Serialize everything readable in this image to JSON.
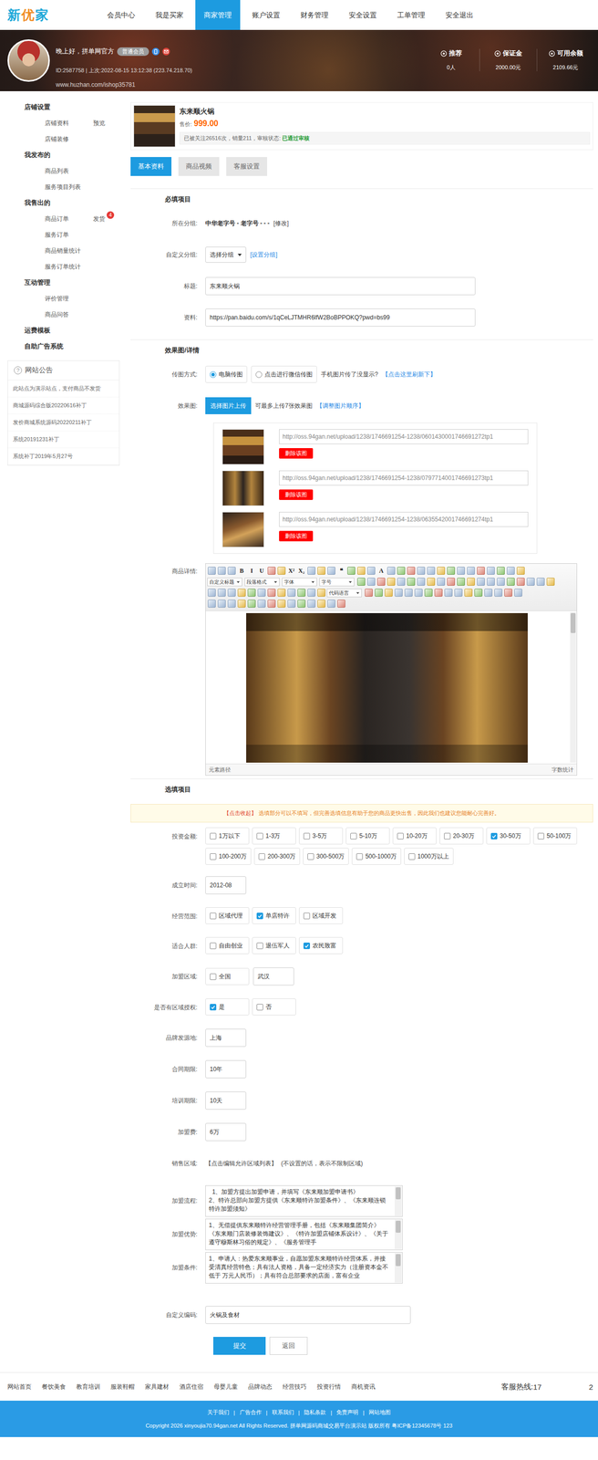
{
  "topnav": {
    "logo": [
      {
        "char": "新",
        "color": "#1aa7d8"
      },
      {
        "char": "优",
        "color": "#f08c1e"
      },
      {
        "char": "家",
        "color": "#1aa7d8"
      }
    ],
    "items": [
      {
        "label": "会员中心",
        "selected": false
      },
      {
        "label": "我是买家",
        "selected": false
      },
      {
        "label": "商家管理",
        "selected": true
      },
      {
        "label": "账户设置",
        "selected": false
      },
      {
        "label": "财务管理",
        "selected": false
      },
      {
        "label": "安全设置",
        "selected": false
      },
      {
        "label": "工单管理",
        "selected": false
      },
      {
        "label": "安全退出",
        "selected": false
      }
    ]
  },
  "banner": {
    "greeting": "晚上好，拼单网官方",
    "badge": "普通会员",
    "meta": "ID:2587758 | 上次:2022-08-15 13:12:38 (223.74.218.70)",
    "watermark": "www.huzhan.com/ishop35781",
    "stats": [
      {
        "label": "推荐",
        "value": "0人"
      },
      {
        "label": "保证金",
        "value": "2000.00元"
      },
      {
        "label": "可用余额",
        "value": "2109.66元"
      }
    ]
  },
  "sidebar": {
    "groups": [
      {
        "title": "店铺设置",
        "items": [
          {
            "label": "店铺资料",
            "extra": "预览"
          },
          {
            "label": "店铺装修"
          }
        ]
      },
      {
        "title": "我发布的",
        "items": [
          {
            "label": "商品列表"
          },
          {
            "label": "服务项目列表"
          }
        ]
      },
      {
        "title": "我售出的",
        "items": [
          {
            "label": "商品订单",
            "extra": "发货",
            "badge": "4"
          },
          {
            "label": "服务订单"
          },
          {
            "label": "商品销量统计"
          },
          {
            "label": "服务订单统计"
          }
        ]
      },
      {
        "title": "互动管理",
        "items": [
          {
            "label": "评价管理"
          },
          {
            "label": "商品问答"
          }
        ]
      },
      {
        "title": "运费模板",
        "items": []
      },
      {
        "title": "自助广告系统",
        "items": []
      }
    ],
    "notice": {
      "icon": "?",
      "title": "网站公告",
      "items": [
        "此站点为演示站点，支付商品不发货",
        "商城源码综合版20220616补丁",
        "发价商城系统源码20220211补丁",
        "系统20191231补丁",
        "系统补丁2019年5月27号"
      ]
    }
  },
  "product": {
    "name": "东来顺火锅",
    "price_label": "售价:",
    "price": "999.00",
    "stats": "已被关注26516次，销量211，审核状态: ",
    "status": "已通过审核"
  },
  "tabs": [
    {
      "label": "基本资料",
      "selected": true
    },
    {
      "label": "商品视频",
      "selected": false
    },
    {
      "label": "客服设置",
      "selected": false
    }
  ],
  "required": {
    "title": "必填项目",
    "group": {
      "label": "所在分组:",
      "value": "中华老字号 - 老字号 - - -",
      "link": "[修改]"
    },
    "custom_group": {
      "label": "自定义分组:",
      "select": "选择分组",
      "link": "[设置分组]"
    },
    "title_field": {
      "label": "标题:",
      "value": "东来顺火锅"
    },
    "resource": {
      "label": "资料:",
      "value": "https://pan.baidu.com/s/1qCeLJTMHR6lfW2BoBPPOKQ?pwd=bs99"
    }
  },
  "media": {
    "title": "效果图/详情",
    "upload_mode": {
      "label": "传图方式:",
      "options": [
        {
          "label": "电脑传图",
          "selected": true
        },
        {
          "label": "点击进行微信传图",
          "selected": false
        }
      ],
      "hint": "手机图片传了没显示?",
      "refresh": "【点击这里刷新下】"
    },
    "images": {
      "label": "效果图:",
      "button": "选择图片上传",
      "hint": "可最多上传7张效果图",
      "order": "【调整图片顺序】",
      "items": [
        {
          "url": "http://oss.94gan.net/upload/1238/1746691254-1238/0601430001746691272tp1",
          "delete": "删除该图"
        },
        {
          "url": "http://oss.94gan.net/upload/1238/1746691254-1238/0797714001746691273tp1",
          "delete": "删除该图"
        },
        {
          "url": "http://oss.94gan.net/upload/1238/1746691254-1238/0635542001746691274tp1",
          "delete": "删除该图"
        }
      ]
    },
    "detail": {
      "label": "商品详情:",
      "toolbar": [
        [
          {
            "kind": "icon"
          },
          {
            "kind": "icon"
          },
          {
            "kind": "icon"
          },
          {
            "kind": "text",
            "label": "B"
          },
          {
            "kind": "text",
            "label": "I"
          },
          {
            "kind": "text",
            "label": "U"
          },
          {
            "kind": "icon"
          },
          {
            "kind": "icon"
          },
          {
            "kind": "text",
            "label": "X²"
          },
          {
            "kind": "text",
            "label": "X₂"
          },
          {
            "kind": "icon"
          },
          {
            "kind": "icon"
          },
          {
            "kind": "icon"
          },
          {
            "kind": "text",
            "label": "❝"
          },
          {
            "kind": "icon"
          },
          {
            "kind": "icon"
          },
          {
            "kind": "icon"
          },
          {
            "kind": "text",
            "label": "A"
          },
          {
            "kind": "icon"
          },
          {
            "kind": "icon"
          },
          {
            "kind": "icon"
          },
          {
            "kind": "icon"
          },
          {
            "kind": "icon"
          },
          {
            "kind": "icon"
          },
          {
            "kind": "icon"
          },
          {
            "kind": "icon"
          },
          {
            "kind": "icon"
          },
          {
            "kind": "icon"
          },
          {
            "kind": "icon"
          },
          {
            "kind": "icon"
          },
          {
            "kind": "icon"
          },
          {
            "kind": "icon"
          }
        ],
        [
          {
            "kind": "select",
            "label": "自定义标题"
          },
          {
            "kind": "select",
            "label": "段落格式"
          },
          {
            "kind": "select",
            "label": "字体"
          },
          {
            "kind": "select",
            "label": "字号"
          },
          {
            "kind": "icon"
          },
          {
            "kind": "icon"
          },
          {
            "kind": "icon"
          },
          {
            "kind": "icon"
          },
          {
            "kind": "icon"
          },
          {
            "kind": "icon"
          },
          {
            "kind": "icon"
          },
          {
            "kind": "icon"
          },
          {
            "kind": "icon"
          },
          {
            "kind": "icon"
          },
          {
            "kind": "icon"
          },
          {
            "kind": "icon"
          },
          {
            "kind": "icon"
          },
          {
            "kind": "icon"
          },
          {
            "kind": "icon"
          },
          {
            "kind": "icon"
          },
          {
            "kind": "icon"
          },
          {
            "kind": "icon"
          },
          {
            "kind": "icon"
          },
          {
            "kind": "icon"
          }
        ],
        [
          {
            "kind": "icon"
          },
          {
            "kind": "icon"
          },
          {
            "kind": "icon"
          },
          {
            "kind": "icon"
          },
          {
            "kind": "icon"
          },
          {
            "kind": "icon"
          },
          {
            "kind": "icon"
          },
          {
            "kind": "icon"
          },
          {
            "kind": "icon"
          },
          {
            "kind": "icon"
          },
          {
            "kind": "icon"
          },
          {
            "kind": "icon"
          },
          {
            "kind": "select",
            "label": "代码语言"
          },
          {
            "kind": "icon"
          },
          {
            "kind": "icon"
          },
          {
            "kind": "icon"
          },
          {
            "kind": "icon"
          },
          {
            "kind": "icon"
          },
          {
            "kind": "icon"
          },
          {
            "kind": "icon"
          },
          {
            "kind": "icon"
          },
          {
            "kind": "icon"
          },
          {
            "kind": "icon"
          },
          {
            "kind": "icon"
          },
          {
            "kind": "icon"
          },
          {
            "kind": "icon"
          },
          {
            "kind": "icon"
          },
          {
            "kind": "icon"
          },
          {
            "kind": "icon"
          }
        ],
        [
          {
            "kind": "icon"
          },
          {
            "kind": "icon"
          },
          {
            "kind": "icon"
          },
          {
            "kind": "icon"
          },
          {
            "kind": "icon"
          },
          {
            "kind": "icon"
          },
          {
            "kind": "icon"
          },
          {
            "kind": "icon"
          },
          {
            "kind": "icon"
          },
          {
            "kind": "icon"
          },
          {
            "kind": "icon"
          },
          {
            "kind": "icon"
          },
          {
            "kind": "icon"
          },
          {
            "kind": "icon"
          }
        ]
      ],
      "path": "元素路径",
      "count": "字数统计"
    }
  },
  "optional": {
    "title": "选填项目",
    "notice": {
      "link": "【点击收起】",
      "text": "选填部分可以不填写，但完善选填信息有助于您的商品更快出售，因此我们也建议您能耐心完善好。"
    },
    "fields": [
      {
        "kind": "checks",
        "label": "投资金额:",
        "options": [
          {
            "label": "1万以下",
            "checked": false
          },
          {
            "label": "1-3万",
            "checked": false
          },
          {
            "label": "3-5万",
            "checked": false
          },
          {
            "label": "5-10万",
            "checked": false
          },
          {
            "label": "10-20万",
            "checked": false
          },
          {
            "label": "20-30万",
            "checked": false
          },
          {
            "label": "30-50万",
            "checked": true
          },
          {
            "label": "50-100万",
            "checked": false
          },
          {
            "label": "100-200万",
            "checked": false
          },
          {
            "label": "200-300万",
            "checked": false
          },
          {
            "label": "300-500万",
            "checked": false
          },
          {
            "label": "500-1000万",
            "checked": false
          },
          {
            "label": "1000万以上",
            "checked": false
          }
        ]
      },
      {
        "kind": "input",
        "label": "成立时间:",
        "value": "2012-08"
      },
      {
        "kind": "checks",
        "label": "经营范围:",
        "options": [
          {
            "label": "区域代理",
            "checked": false
          },
          {
            "label": "单店特许",
            "checked": true
          },
          {
            "label": "区域开发",
            "checked": false
          }
        ]
      },
      {
        "kind": "checks",
        "label": "适合人群:",
        "options": [
          {
            "label": "自由创业",
            "checked": false
          },
          {
            "label": "退伍军人",
            "checked": false
          },
          {
            "label": "农民致富",
            "checked": true
          }
        ]
      },
      {
        "kind": "checks_input",
        "label": "加盟区域:",
        "options": [
          {
            "label": "全国",
            "checked": false
          }
        ],
        "value": "武汉"
      },
      {
        "kind": "checks",
        "label": "是否有区域授权:",
        "options": [
          {
            "label": "是",
            "checked": true
          },
          {
            "label": "否",
            "checked": false
          }
        ]
      },
      {
        "kind": "input",
        "label": "品牌发源地:",
        "value": "上海"
      },
      {
        "kind": "input",
        "label": "合同期限:",
        "value": "10年"
      },
      {
        "kind": "input",
        "label": "培训期限:",
        "value": "10天"
      },
      {
        "kind": "input",
        "label": "加盟费:",
        "value": "6万"
      },
      {
        "kind": "link",
        "label": "销售区域:",
        "link": "【点击编辑允许区域列表】",
        "hint": "(不设置的话，表示不限制区域)"
      },
      {
        "kind": "textarea",
        "label": "加盟流程:",
        "value": "  1、加盟方提出加盟申请，并填写《东来顺加盟申请书》\n2、特许总部向加盟方提供《东来顺特许加盟条件》、《东来顺连锁特许加盟须知》"
      },
      {
        "kind": "textarea",
        "label": "加盟优势:",
        "value": "1、无偿提供东来顺特许经营管理手册，包括《东来顺集团简介》《东来顺门店装修装饰建议》、《特许加盟店铺体系设计》、《关于遵守穆斯林习俗的规定》、《服务管理手"
      },
      {
        "kind": "textarea",
        "label": "加盟条件:",
        "value": "1、申请人：热爱东来顺事业，自愿加盟东来顺特许经营体系，并接受清真经营特色；具有法人资格，具备一定经济实力（注册资本金不低于 万元人民币）；具有符合总部要求的店面，富有企业"
      },
      {
        "kind": "input_wide",
        "label": "自定义编码:",
        "value": "火锅及食材"
      }
    ]
  },
  "actions": {
    "submit": "提交",
    "back": "返回"
  },
  "footer": {
    "links": [
      "网站首页",
      "餐饮美食",
      "教育培训",
      "服装鞋帽",
      "家具建材",
      "酒店住宿",
      "母婴儿童",
      "品牌动态",
      "经营技巧",
      "投资行情",
      "商机资讯"
    ],
    "hotline": {
      "label": "客服热线:",
      "value": "17",
      "tail": "2"
    },
    "bottom_links": [
      "关于我们",
      "广告合作",
      "联系我们",
      "隐私条款",
      "免责声明",
      "网站地图"
    ],
    "separator": "|",
    "copyright": "Copyright 2026 xinyoujia70.94gan.net All Rights Reserved. 拼单网源码商城交易平台演示站 版权所有 粤ICP备12345678号 123"
  }
}
